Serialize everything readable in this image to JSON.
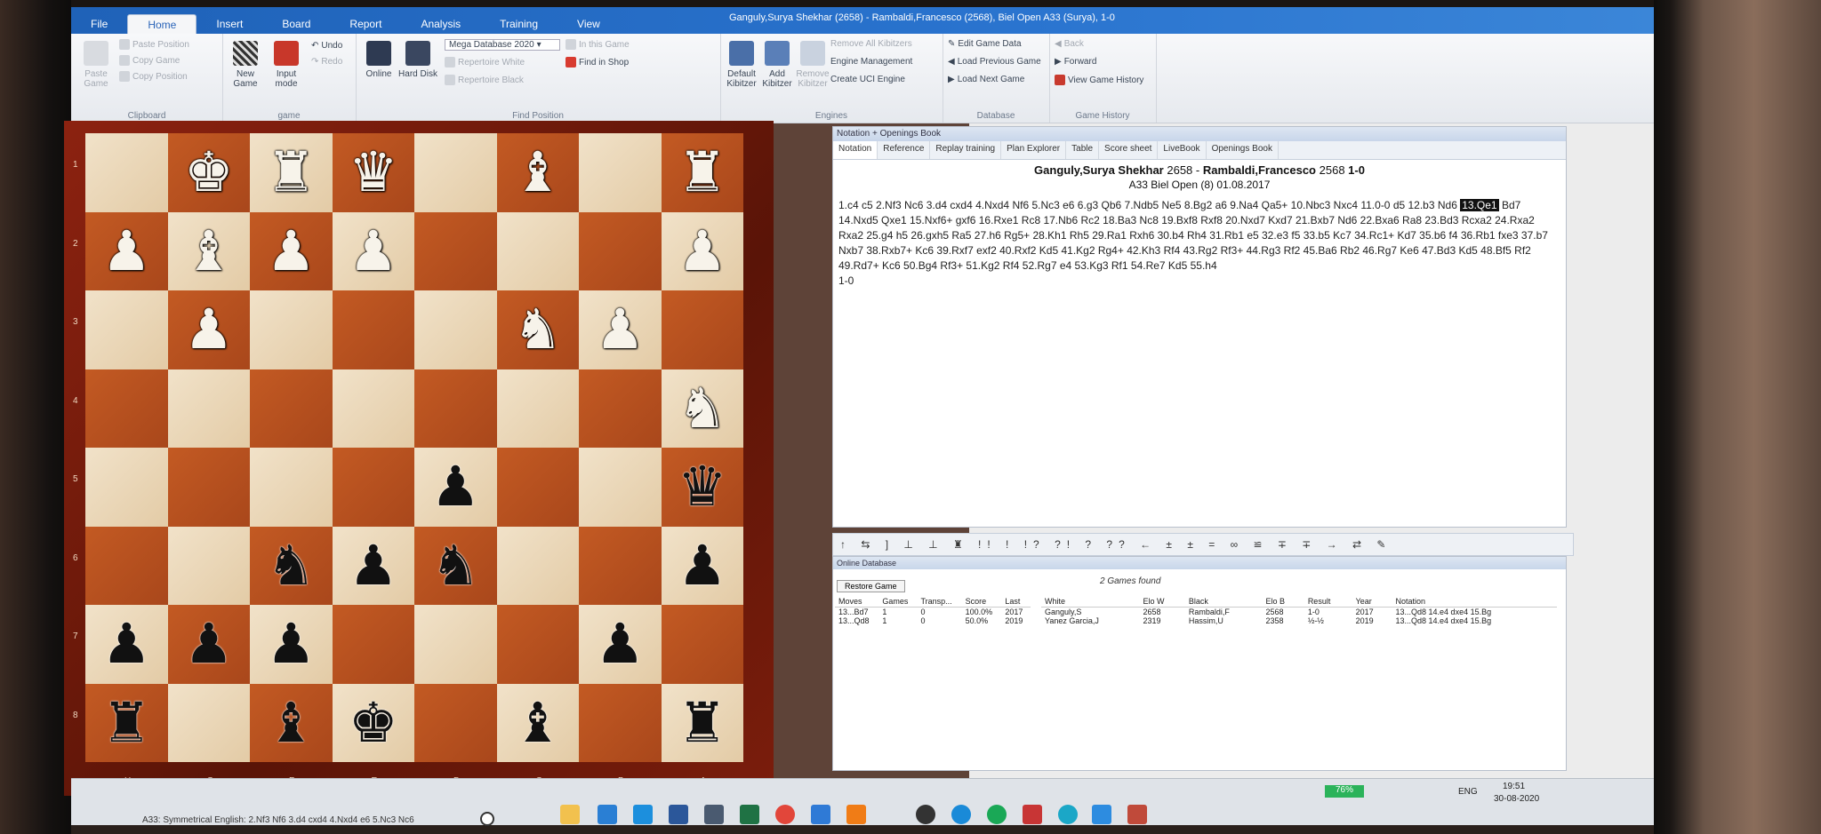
{
  "window_title": "Ganguly,Surya Shekhar (2658) - Rambaldi,Francesco (2568), Biel Open  A33  (Surya), 1-0",
  "ribbon_tabs": [
    "File",
    "Home",
    "Insert",
    "Board",
    "Report",
    "Analysis",
    "Training",
    "View"
  ],
  "ribbon": {
    "clipboard": {
      "label": "Clipboard",
      "paste_game": "Paste Game",
      "paste_position": "Paste Position",
      "copy_game": "Copy Game",
      "copy_position": "Copy Position"
    },
    "game": {
      "label": "game",
      "new_game": "New Game",
      "input_mode": "Input mode",
      "undo": "Undo",
      "redo": "Redo"
    },
    "find": {
      "label": "Find Position",
      "online": "Online",
      "hard_disk": "Hard Disk",
      "database": "Mega Database 2020",
      "in_this_game": "In this Game",
      "repertoire_white": "Repertoire White",
      "repertoire_black": "Repertoire Black",
      "find_in_shop": "Find in Shop"
    },
    "engines": {
      "label": "Engines",
      "default_kibitzer": "Default Kibitzer",
      "add_kibitzer": "Add Kibitzer",
      "remove_kibitzer": "Remove Kibitzer",
      "remove_all": "Remove All Kibitzers",
      "engine_mgmt": "Engine Management",
      "create_uci": "Create UCI Engine"
    },
    "database": {
      "label": "Database",
      "edit_game_data": "Edit Game Data",
      "load_prev": "Load Previous Game",
      "load_next": "Load Next Game"
    },
    "history": {
      "label": "Game History",
      "back": "Back",
      "forward": "Forward",
      "view_history": "View Game History"
    }
  },
  "board": {
    "ranks": [
      "1",
      "2",
      "3",
      "4",
      "5",
      "6",
      "7",
      "8"
    ],
    "files": [
      "H",
      "G",
      "F",
      "E",
      "D",
      "C",
      "B",
      "A"
    ],
    "rows": [
      [
        "",
        "wK",
        "wR",
        "wQ",
        "",
        "wB",
        "",
        "wR"
      ],
      [
        "wP",
        "wB",
        "wP",
        "wP",
        "",
        "",
        "",
        "wP"
      ],
      [
        "",
        "wP",
        "",
        "",
        "",
        "wN",
        "wP",
        ""
      ],
      [
        "",
        "",
        "",
        "",
        "",
        "",
        "",
        "wN"
      ],
      [
        "",
        "",
        "",
        "",
        "bP",
        "",
        "",
        "bQ"
      ],
      [
        "",
        "",
        "bN",
        "bP",
        "bN",
        "",
        "",
        "bP"
      ],
      [
        "bP",
        "bP",
        "bP",
        "",
        "",
        "",
        "bP",
        ""
      ],
      [
        "bR",
        "",
        "bB",
        "bK",
        "",
        "bB",
        "",
        "bR"
      ]
    ]
  },
  "panel": {
    "header": "Notation + Openings Book",
    "tabs": [
      "Notation",
      "Reference",
      "Replay training",
      "Plan Explorer",
      "Table",
      "Score sheet",
      "LiveBook",
      "Openings Book"
    ],
    "white": "Ganguly,Surya Shekhar",
    "white_elo": "2658",
    "black": "Rambaldi,Francesco",
    "black_elo": "2568",
    "result": "1-0",
    "event_line": "A33 Biel Open (8) 01.08.2017",
    "moves_before": "1.c4 c5 2.Nf3 Nc6 3.d4 cxd4 4.Nxd4 Nf6 5.Nc3 e6 6.g3 Qb6 7.Ndb5 Ne5 8.Bg2 a6 9.Na4 Qa5+ 10.Nbc3 Nxc4 11.0-0 d5 12.b3 Nd6",
    "current_move": "13.Qe1",
    "moves_after": "Bd7 14.Nxd5 Qxe1 15.Nxf6+ gxf6 16.Rxe1 Rc8 17.Nb6 Rc2 18.Ba3 Nc8 19.Bxf8 Rxf8 20.Nxd7 Kxd7 21.Bxb7 Nd6 22.Bxa6 Ra8 23.Bd3 Rcxa2 24.Rxa2 Rxa2 25.g4 h5 26.gxh5 Ra5 27.h6 Rg5+ 28.Kh1 Rh5 29.Ra1 Rxh6 30.b4 Rh4 31.Rb1 e5 32.e3 f5 33.b5 Kc7 34.Rc1+ Kd7 35.b6 f4 36.Rb1 fxe3 37.b7 Nxb7 38.Rxb7+ Kc6 39.Rxf7 exf2 40.Rxf2 Kd5 41.Kg2 Rg4+ 42.Kh3 Rf4 43.Rg2 Rf3+ 44.Rg3 Rf2 45.Ba6 Rb2 46.Rg7 Ke6 47.Bd3 Kd5 48.Bf5 Rf2 49.Rd7+ Kc6 50.Bg4 Rf3+ 51.Kg2 Rf4 52.Rg7 e4 53.Kg3 Rf1 54.Re7 Kd5 55.h4",
    "final_result": "1-0",
    "symbols": "↑ ⇆ ] ⊥ ⊥ ♜ !! ! !? ?! ? ?? ← ± ± = ∞ ≌ ∓ ∓ → ⇄ ✎"
  },
  "online_db": {
    "header": "Online Database",
    "restore": "Restore Game",
    "found": "2 Games found",
    "move_cols": [
      "Moves",
      "Games",
      "Transp...",
      "Score",
      "Last"
    ],
    "move_rows": [
      [
        "13...Bd7",
        "1",
        "0",
        "100.0%",
        "2017"
      ],
      [
        "13...Qd8",
        "1",
        "0",
        "50.0%",
        "2019"
      ]
    ],
    "game_cols": [
      "White",
      "Elo W",
      "Black",
      "Elo B",
      "Result",
      "Year",
      "Notation"
    ],
    "game_rows": [
      [
        "Ganguly,S",
        "2658",
        "Rambaldi,F",
        "2568",
        "1-0",
        "2017",
        "13...Qd8 14.e4 dxe4 15.Bg"
      ],
      [
        "Yanez Garcia,J",
        "2319",
        "Hassim,U",
        "2358",
        "½-½",
        "2019",
        "13...Qd8 14.e4 dxe4 15.Bg"
      ]
    ]
  },
  "status_bar": "A33: Symmetrical English: 2.Nf3 Nf6 3.d4 cxd4 4.Nxd4 e6 5.Nc3 Nc6",
  "taskbar": {
    "battery": "76%",
    "lang": "ENG",
    "time": "19:51",
    "date": "30-08-2020"
  }
}
